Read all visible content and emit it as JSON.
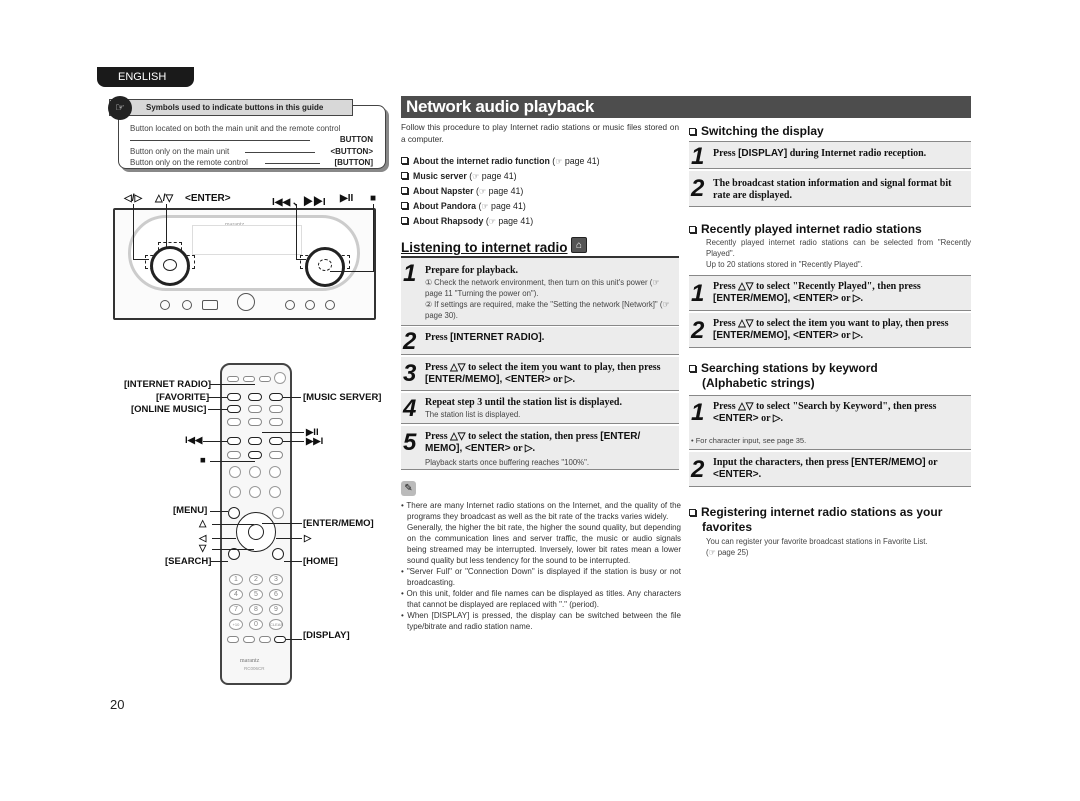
{
  "language_tab": "ENGLISH",
  "symbols_box": {
    "heading": "Symbols used to indicate buttons in this guide",
    "line1": "Button located on both the main unit and the remote control",
    "tag1": "BUTTON",
    "line2": "Button only on the main unit",
    "tag2": "<BUTTON>",
    "line3": "Button only on the remote control",
    "tag3": "[BUTTON]"
  },
  "main_unit": {
    "labels": {
      "left_right": "◁/▷",
      "up_down": "△/▽",
      "enter": "<ENTER>",
      "skip": "I◀◀ 、▶▶I",
      "play_pause": "▶II",
      "stop": "■"
    },
    "brand": "marantz"
  },
  "remote": {
    "left_labels": {
      "internet_radio": "[INTERNET RADIO]",
      "favorite": "[FAVORITE]",
      "online_music": "[ONLINE MUSIC]",
      "skip_back": "I◀◀",
      "stop": "■",
      "menu": "[MENU]",
      "up": "△",
      "left": "◁",
      "down": "▽",
      "search": "[SEARCH]"
    },
    "right_labels": {
      "music_server": "[MUSIC SERVER]",
      "play_pause": "▶II",
      "skip_fwd": "▶▶I",
      "enter_memo": "[ENTER/MEMO]",
      "right": "▷",
      "home": "[HOME]",
      "display": "[DISPLAY]"
    },
    "keypad": [
      "1",
      "2",
      "3",
      "4",
      "5",
      "6",
      "7",
      "8",
      "9",
      "+10",
      "0",
      "CLEAR"
    ],
    "brand": "marantz",
    "model": "RC006CR"
  },
  "page_number": "20",
  "title": "Network audio playback",
  "intro": "Follow this procedure to play Internet radio stations or music files stored on a computer.",
  "references": [
    {
      "label": "About the internet radio function",
      "page": "page 41"
    },
    {
      "label": "Music server",
      "page": "page 41"
    },
    {
      "label": "About Napster",
      "page": "page 41"
    },
    {
      "label": "About Pandora",
      "page": "page 41"
    },
    {
      "label": "About Rhapsody",
      "page": "page 41"
    }
  ],
  "listening": {
    "heading": "Listening to internet radio",
    "steps": [
      {
        "num": "1",
        "title": "Prepare for playback.",
        "body1": "① Check the network environment, then turn on this unit's power (☞ page 11 \"Turning the power on\").",
        "body2": "② If settings are required, make the \"Setting the network [Network]\" (☞ page 30)."
      },
      {
        "num": "2",
        "title_a": "Press ",
        "title_ui": "[INTERNET RADIO]",
        "title_b": "."
      },
      {
        "num": "3",
        "title_a": "Press △▽ to select the item you want to play, then press ",
        "title_ui": "[ENTER/MEMO], <ENTER>",
        "title_b": " or ▷."
      },
      {
        "num": "4",
        "title": "Repeat step 3 until the station list is displayed.",
        "body": "The station list is displayed."
      },
      {
        "num": "5",
        "title_a": "Press △▽ to select the station, then press ",
        "title_ui": "[ENTER/ MEMO], <ENTER>",
        "title_b": " or ▷.",
        "body": "Playback starts once buffering reaches \"100%\"."
      }
    ]
  },
  "notes": {
    "icon": "pencil-note",
    "items": [
      "There are many Internet radio stations on the Internet, and the quality of the programs they broadcast as well as the bit rate of the tracks varies widely.",
      "Generally, the higher the bit rate, the higher the sound quality, but depending on the communication lines and server traffic, the music or audio signals being streamed may be interrupted. Inversely, lower bit rates mean a lower sound quality but less tendency for the sound to be interrupted.",
      "\"Server Full\" or \"Connection Down\" is displayed if the station is busy or not broadcasting.",
      "On this unit, folder and file names can be displayed as titles. Any characters that cannot be displayed are replaced with \".\" (period).",
      "When [DISPLAY] is pressed, the display can be switched between the file type/bitrate and radio station name."
    ]
  },
  "switching": {
    "heading": "Switching the display",
    "step1_a": "Press ",
    "step1_ui": "[DISPLAY]",
    "step1_b": " during Internet radio reception.",
    "step2": "The broadcast station information and signal format bit rate are displayed."
  },
  "recently": {
    "heading": "Recently played internet radio stations",
    "body1": "Recently played internet radio stations can be selected from \"Recently Played\".",
    "body2": "Up to 20 stations stored in \"Recently Played\".",
    "step1_a": "Press △▽ to select \"Recently Played\", then press ",
    "step1_ui": "[ENTER/MEMO], <ENTER>",
    "step1_b": " or ▷.",
    "step2_a": "Press △▽ to select the item you want to play, then press ",
    "step2_ui": "[ENTER/MEMO], <ENTER>",
    "step2_b": " or ▷."
  },
  "searching": {
    "heading1": "Searching stations by keyword",
    "heading2": "(Alphabetic strings)",
    "step1_a": "Press △▽ to select \"Search by Keyword\", then press ",
    "step1_ui": "<ENTER>",
    "step1_b": " or ▷.",
    "note": "• For character input, see page 35.",
    "step2_a": "Input the characters, then press ",
    "step2_ui": "[ENTER/MEMO]",
    "step2_b": " or ",
    "step2_ui2": "<ENTER>",
    "step2_c": "."
  },
  "registering": {
    "heading1": "Registering internet radio stations as your",
    "heading2": "favorites",
    "body": "You can register your favorite broadcast stations in Favorite List.",
    "ref": "(☞ page 25)"
  }
}
